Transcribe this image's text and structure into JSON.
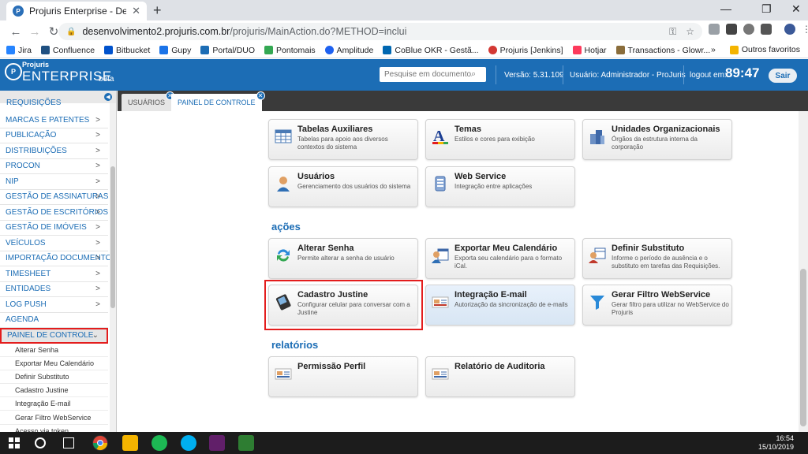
{
  "browser": {
    "tab_title": "Projuris Enterprise - Demo",
    "url_host": "desenvolvimento2.projuris.com.br",
    "url_path": "/projuris/MainAction.do?METHOD=inclui",
    "bookmarks": [
      "Jira",
      "Confluence",
      "Bitbucket",
      "Gupy",
      "Portal/DUO",
      "Pontomais",
      "Amplitude",
      "CoBlue OKR - Gestã...",
      "Projuris [Jenkins]",
      "Hotjar",
      "Transactions - Glowr..."
    ],
    "bookmarks_more": "»",
    "other_bookmarks": "Outros favoritos"
  },
  "header": {
    "logo_top": "Projuris",
    "logo_main": "ENTERPRISE",
    "logo_beta": "beta",
    "search_placeholder": "Pesquise em documentos",
    "version": "Versão: 5.31.109",
    "user": "Usuário: Administrador - ProJuris",
    "logout_label": "logout em:",
    "timer": "89:47",
    "exit_button": "Sair"
  },
  "sidebar": {
    "partial_top": "REQUISIÇÕES",
    "items": [
      {
        "label": "MARCAS E PATENTES",
        "chev": ">"
      },
      {
        "label": "PUBLICAÇÃO",
        "chev": ">"
      },
      {
        "label": "DISTRIBUIÇÕES",
        "chev": ">"
      },
      {
        "label": "PROCON",
        "chev": ">"
      },
      {
        "label": "NIP",
        "chev": ">"
      },
      {
        "label": "GESTÃO DE ASSINATURAS",
        "chev": ">"
      },
      {
        "label": "GESTÃO DE ESCRITÓRIOS",
        "chev": ">"
      },
      {
        "label": "GESTÃO DE IMÓVEIS",
        "chev": ">"
      },
      {
        "label": "VEÍCULOS",
        "chev": ">"
      },
      {
        "label": "IMPORTAÇÃO DOCUMENTOS",
        "chev": ">"
      },
      {
        "label": "TIMESHEET",
        "chev": ">"
      },
      {
        "label": "ENTIDADES",
        "chev": ">"
      },
      {
        "label": "LOG PUSH",
        "chev": ">"
      },
      {
        "label": "AGENDA",
        "chev": ""
      }
    ],
    "active_item": {
      "label": "PAINEL DE CONTROLE",
      "chev": "⌄"
    },
    "subitems": [
      "Alterar Senha",
      "Exportar Meu Calendário",
      "Definir Substituto",
      "Cadastro Justine",
      "Integração E-mail",
      "Gerar Filtro WebService",
      "Acesso via token"
    ]
  },
  "tabs": [
    {
      "label": "USUÁRIOS",
      "active": false
    },
    {
      "label": "PAINEL DE CONTROLE",
      "active": true
    }
  ],
  "content": {
    "cards_top": [
      {
        "title": "Tabelas Auxiliares",
        "desc": "Tabelas para apoio aos diversos contextos do sistema",
        "icon": "table-icon"
      },
      {
        "title": "Temas",
        "desc": "Estilos e cores para exibição",
        "icon": "theme-icon"
      },
      {
        "title": "Unidades Organizacionais",
        "desc": "Órgãos da estrutura interna da corporação",
        "icon": "buildings-icon"
      },
      {
        "title": "Usuários",
        "desc": "Gerenciamento dos usuários do sistema",
        "icon": "user-icon"
      },
      {
        "title": "Web Service",
        "desc": "Integração entre aplicações",
        "icon": "webservice-icon"
      }
    ],
    "section_actions": "ações",
    "cards_actions": [
      {
        "title": "Alterar Senha",
        "desc": "Permite alterar a senha de usuário",
        "icon": "refresh-icon"
      },
      {
        "title": "Exportar Meu Calendário",
        "desc": "Exporta seu calendário para o formato iCal.",
        "icon": "calendar-export-icon"
      },
      {
        "title": "Definir Substituto",
        "desc": "Informe o período de ausência e o substituto em tarefas das Requisições.",
        "icon": "substitute-icon"
      },
      {
        "title": "Cadastro Justine",
        "desc": "Configurar celular para conversar com a Justine",
        "icon": "phone-icon"
      },
      {
        "title": "Integração E-mail",
        "desc": "Autorização da sincronização de e-mails",
        "icon": "email-icon"
      },
      {
        "title": "Gerar Filtro WebService",
        "desc": "Gerar filtro para utilizar no WebService do Projuris",
        "icon": "filter-icon"
      }
    ],
    "section_reports": "relatórios",
    "cards_reports": [
      {
        "title": "Permissão Perfil",
        "desc": "",
        "icon": "report-icon"
      },
      {
        "title": "Relatório de Auditoria",
        "desc": "",
        "icon": "audit-report-icon"
      }
    ]
  },
  "taskbar": {
    "time": "16:54",
    "date": "15/10/2019"
  }
}
